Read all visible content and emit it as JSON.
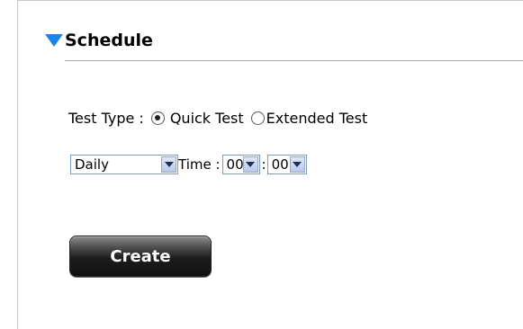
{
  "section": {
    "title": "Schedule",
    "icon": "triangle-down-icon",
    "accent_color": "#1a85e5"
  },
  "test_type": {
    "label": "Test Type :",
    "options": [
      {
        "label": "Quick Test",
        "selected": true
      },
      {
        "label": "Extended Test",
        "selected": false
      }
    ]
  },
  "schedule": {
    "frequency": {
      "value": "Daily"
    },
    "time_label": "Time :",
    "hour": {
      "value": "00"
    },
    "separator": ":",
    "minute": {
      "value": "00"
    }
  },
  "actions": {
    "create_label": "Create"
  }
}
